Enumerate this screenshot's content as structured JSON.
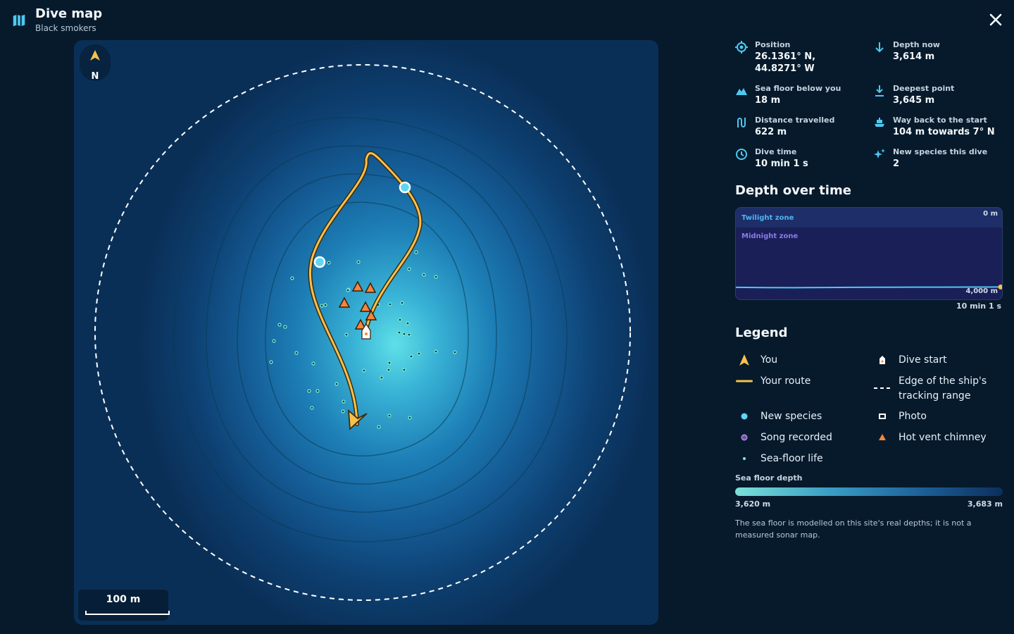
{
  "header": {
    "title": "Dive map",
    "subtitle": "Black smokers"
  },
  "map": {
    "north_label": "N",
    "scale_label": "100 m",
    "route_color": "#f7c14a",
    "species_color": "#5fd6f2",
    "vent_color": "#f5863a"
  },
  "stats": {
    "position": {
      "label": "Position",
      "value_lat": "26.1361° N,",
      "value_lon": "44.8271° W"
    },
    "depth_now": {
      "label": "Depth now",
      "value": "3,614 m"
    },
    "sea_floor_below": {
      "label": "Sea floor below you",
      "value": "18 m"
    },
    "deepest_point": {
      "label": "Deepest point",
      "value": "3,645 m"
    },
    "distance": {
      "label": "Distance travelled",
      "value": "622 m"
    },
    "way_back": {
      "label": "Way back to the start",
      "value": "104 m towards 7° N"
    },
    "dive_time": {
      "label": "Dive time",
      "value": "10 min 1 s"
    },
    "new_species": {
      "label": "New species this dive",
      "value": "2"
    }
  },
  "depth_chart": {
    "title": "Depth over time",
    "zones": [
      "Twilight zone",
      "Midnight zone"
    ],
    "top_label": "0 m",
    "bottom_label": "4,000 m",
    "time_label": "10 min 1 s"
  },
  "chart_data": {
    "type": "line",
    "ylim": [
      0,
      4000
    ],
    "x_end_label": "10 min 1 s",
    "series": [
      {
        "values": [
          3630,
          3640,
          3645,
          3638,
          3630,
          3625,
          3620,
          3622,
          3618,
          3614
        ]
      }
    ]
  },
  "legend": {
    "title": "Legend",
    "items": [
      {
        "label": "You"
      },
      {
        "label": "Dive start"
      },
      {
        "label": "Your route"
      },
      {
        "label": "Edge of the ship's tracking range"
      },
      {
        "label": "New species"
      },
      {
        "label": "Photo"
      },
      {
        "label": "Song recorded"
      },
      {
        "label": "Hot vent chimney"
      },
      {
        "label": "Sea-floor life"
      }
    ]
  },
  "sea_floor_depth": {
    "label": "Sea floor depth",
    "min": "3,620 m",
    "max": "3,683 m",
    "note": "The sea floor is modelled on this site's real depths; it is not a measured sonar map."
  }
}
